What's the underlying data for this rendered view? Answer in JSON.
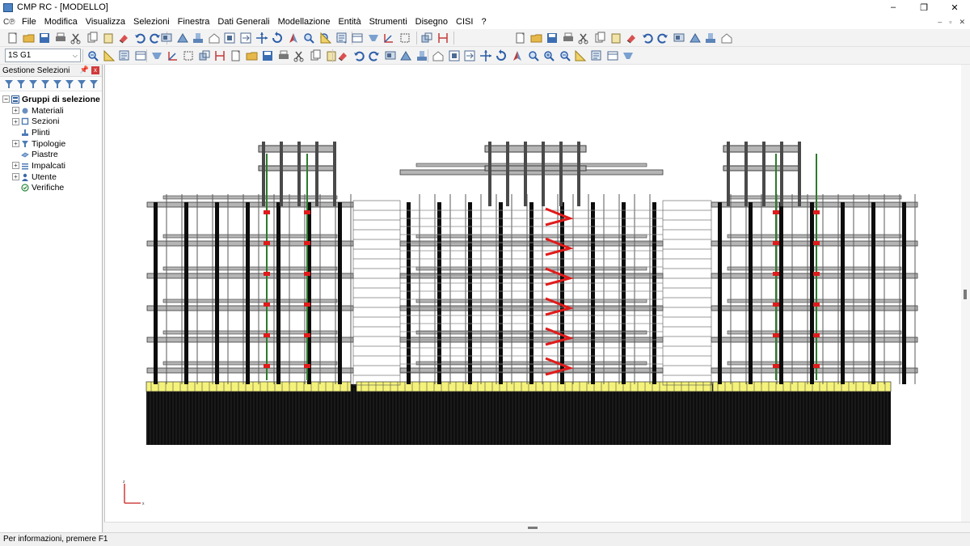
{
  "window": {
    "title": "CMP RC - [MODELLO]",
    "min": "–",
    "restore": "❐",
    "close": "✕"
  },
  "menubar": {
    "logo": "C℗",
    "items": [
      "File",
      "Modifica",
      "Visualizza",
      "Selezioni",
      "Finestra",
      "Dati Generali",
      "Modellazione",
      "Entità",
      "Strumenti",
      "Disegno",
      "CISI",
      "?"
    ],
    "mdi_min": "–",
    "mdi_restore": "▫",
    "mdi_close": "✕"
  },
  "toolbar2": {
    "combo_value": "1S G1",
    "combo_arrow": "⌵"
  },
  "panel": {
    "title": "Gestione Selezioni",
    "pin": "📌",
    "close": "x",
    "tree": {
      "root": "Gruppi di selezione",
      "items": [
        "Materiali",
        "Sezioni",
        "Plinti",
        "Tipologie",
        "Piastre",
        "Impalcati",
        "Utente",
        "Verifiche"
      ]
    }
  },
  "axes": {
    "x_label": "x",
    "z_label": "z"
  },
  "status": {
    "text": "Per informazioni, premere F1"
  },
  "colors": {
    "frame": "#3a3a3a",
    "frame_light": "#b5b5b5",
    "column": "#0d0d0d",
    "slab_yellow": "#f4f27a",
    "rebar_red": "#e01b1b",
    "green": "#2c7a2c"
  }
}
